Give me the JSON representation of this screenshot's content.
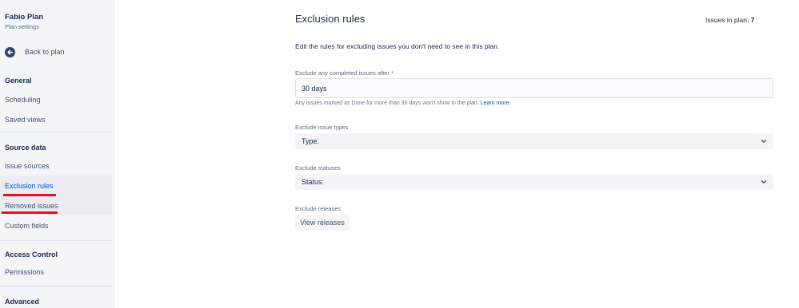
{
  "sidebar": {
    "plan_name": "Fabio Plan",
    "plan_subtitle": "Plan settings",
    "back_label": "Back to plan",
    "sections": {
      "general": "General",
      "source_data": "Source data",
      "access_control": "Access Control",
      "advanced": "Advanced"
    },
    "items": {
      "scheduling": "Scheduling",
      "saved_views": "Saved views",
      "issue_sources": "Issue sources",
      "exclusion_rules": "Exclusion rules",
      "removed_issues": "Removed issues",
      "custom_fields": "Custom fields",
      "permissions": "Permissions"
    },
    "annotation_color": "#e5102a"
  },
  "main": {
    "title": "Exclusion rules",
    "issues_in_plan_label": "Issues in plan:",
    "issues_in_plan_value": "7",
    "description": "Edit the rules for excluding issues you don't need to see in this plan.",
    "completed": {
      "label": "Exclude any completed issues after",
      "required_mark": "*",
      "value": "30 days",
      "helper": "Any issues marked as Done for more than 30 days won't show in the plan.",
      "learn_more": "Learn more"
    },
    "issue_types": {
      "label": "Exclude issue types",
      "select_label": "Type:"
    },
    "statuses": {
      "label": "Exclude statuses",
      "select_label": "Status:"
    },
    "releases": {
      "label": "Exclude releases",
      "button": "View releases"
    }
  }
}
